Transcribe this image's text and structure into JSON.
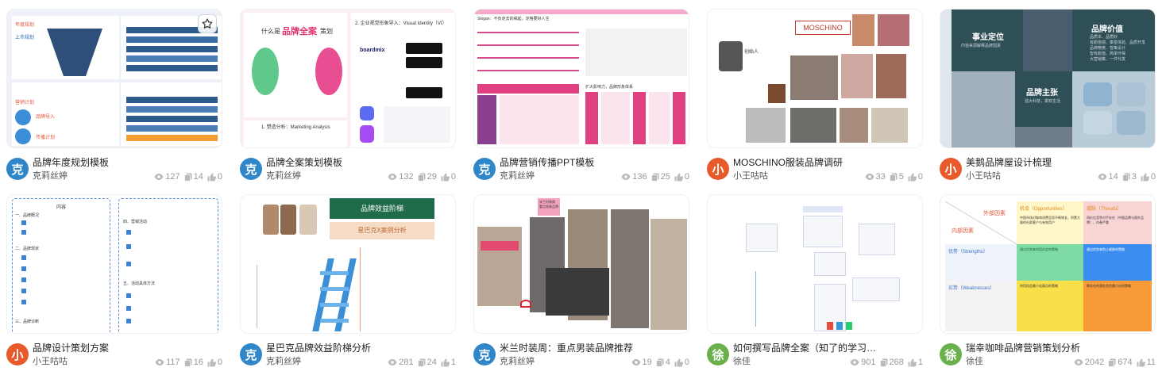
{
  "cards": [
    {
      "title": "品牌年度规划模板",
      "author": "克莉丝婷",
      "avatar_char": "克",
      "avatar_color": "#2f86c9",
      "views": "127",
      "copies": "14",
      "likes": "0",
      "has_star": true
    },
    {
      "title": "品牌全案策划模板",
      "author": "克莉丝婷",
      "avatar_char": "克",
      "avatar_color": "#2f86c9",
      "views": "132",
      "copies": "29",
      "likes": "0"
    },
    {
      "title": "品牌营销传播PPT模板",
      "author": "克莉丝婷",
      "avatar_char": "克",
      "avatar_color": "#2f86c9",
      "views": "136",
      "copies": "25",
      "likes": "0"
    },
    {
      "title": "MOSCHINO服装品牌调研",
      "author": "小王咕咕",
      "avatar_char": "小",
      "avatar_color": "#e85a2c",
      "views": "33",
      "copies": "5",
      "likes": "0"
    },
    {
      "title": "美鹅品牌屋设计梳理",
      "author": "小王咕咕",
      "avatar_char": "小",
      "avatar_color": "#e85a2c",
      "views": "14",
      "copies": "3",
      "likes": "0"
    },
    {
      "title": "品牌设计策划方案",
      "author": "小王咕咕",
      "avatar_char": "小",
      "avatar_color": "#e85a2c",
      "views": "117",
      "copies": "16",
      "likes": "0"
    },
    {
      "title": "星巴克品牌效益阶梯分析",
      "author": "克莉丝婷",
      "avatar_char": "克",
      "avatar_color": "#2f86c9",
      "views": "281",
      "copies": "24",
      "likes": "1"
    },
    {
      "title": "米兰时装周：重点男装品牌推荐",
      "author": "克莉丝婷",
      "avatar_char": "克",
      "avatar_color": "#2f86c9",
      "views": "19",
      "copies": "4",
      "likes": "0"
    },
    {
      "title": "如何撰写品牌全案（知了的学习…",
      "author": "徐佳",
      "avatar_char": "徐",
      "avatar_color": "#6ab04c",
      "views": "901",
      "copies": "268",
      "likes": "1"
    },
    {
      "title": "瑞幸咖啡品牌营销策划分析",
      "author": "徐佳",
      "avatar_char": "徐",
      "avatar_color": "#6ab04c",
      "views": "2042",
      "copies": "674",
      "likes": "11"
    }
  ],
  "thumbs": {
    "t1": {
      "l1": "年度规划",
      "l2": "上市规划",
      "l3": "营销计划",
      "l4": "品牌导入",
      "l5": "传播计划"
    },
    "t2": {
      "q1": "什么是",
      "q2": "品牌全案",
      "q3": "策划",
      "s1": "2. 企业视觉形象导入：Visual Identity（VI）",
      "s2": "1. 塑造分析：Marketing Analysis",
      "brand": "boardmix"
    },
    "t3": {
      "h1": "Slogan：不负走去的缘起，定格要好人生",
      "h2": "扩大影响力，品牌形象体系"
    },
    "t4": {
      "brand": "MOSCHINO",
      "who": "创始人"
    },
    "t5": {
      "a": "事业定位",
      "b": "品牌价值",
      "c": "品牌主张",
      "a2": "内容来源解释品牌因素",
      "b2": "品质本、品质好\n有颜值感、秦皇体验、品质开发\n品牌精英、智策设计\n智有颜值、简单环保\n大营销策、一件代发",
      "c2": "强大科技，柔软生活"
    },
    "t6": {
      "col1": "内容",
      "s1": "一、品牌概况",
      "s2": "二、品牌现状",
      "s3": "三、品牌诊断",
      "s4": "四、营销活动",
      "s5": "五、活动具体方法"
    },
    "t7": {
      "title": "品牌效益阶梯",
      "sub": "星巴克X案例分析"
    },
    "t8": {
      "tag": "米兰时装周\n重点男装品牌"
    },
    "t9": {},
    "t10": {
      "ext": "外部因素",
      "int": "内部因素",
      "o": "机会（Opportunities）",
      "t": "威胁（Threats）",
      "s": "优势（Strengths）",
      "w": "劣势（Weaknesses）",
      "so": "通过优势来利用机会的策略",
      "st": "通过优势来防止威胁的策略",
      "wo": "利用机会最小化弱点的策略",
      "wt": "降存在的潜在危险最小化的策略",
      "o2": "中国市场对咖啡消费呈现不断增长，积累大量的社群客户与有效用户",
      "t2": "同价位竞争对手存在（中国品牌与国外品牌），内卷严重"
    }
  }
}
